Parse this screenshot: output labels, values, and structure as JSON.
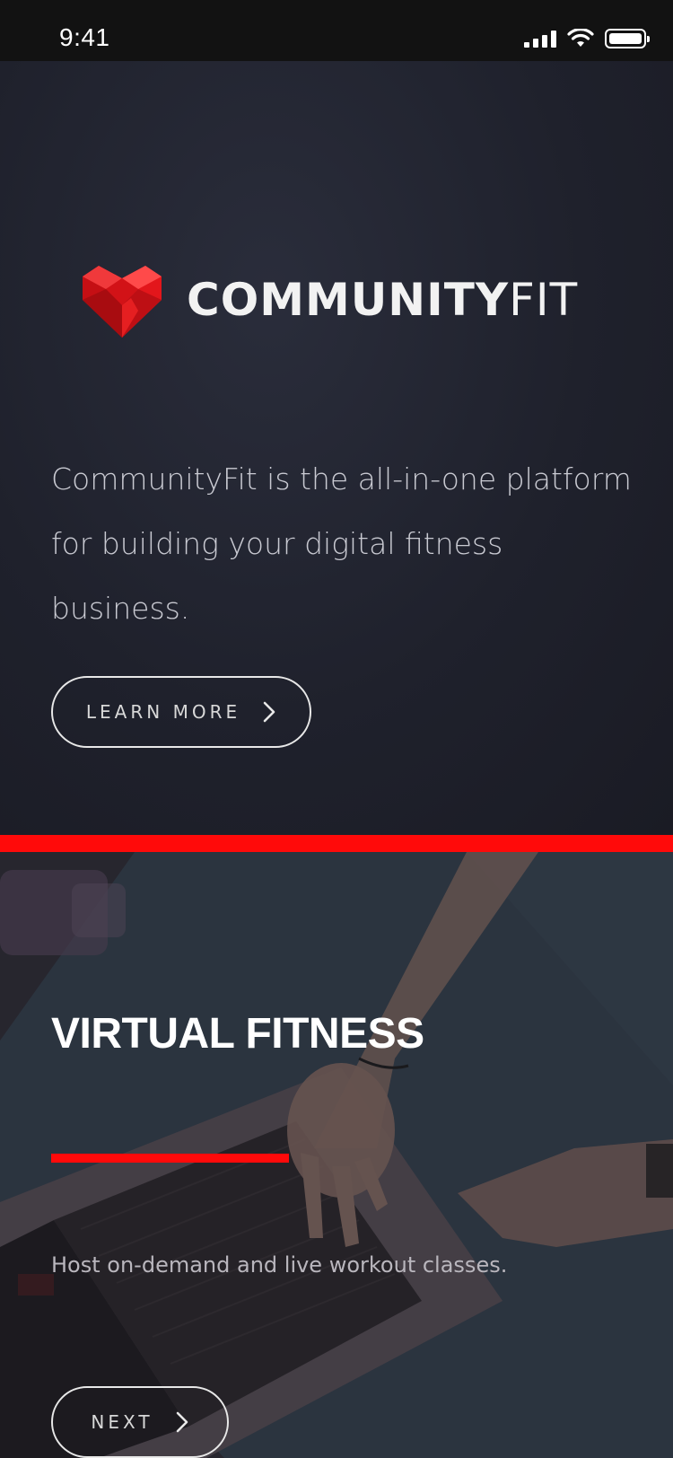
{
  "status_bar": {
    "time": "9:41"
  },
  "hero": {
    "logo": {
      "brand_strong": "COMMUNITY",
      "brand_light": "FIT",
      "accent_color": "#e3161b"
    },
    "description": "CommunityFit is the all-in-one platform for building your digital fitness business.",
    "learn_more_label": "LEARN MORE"
  },
  "feature": {
    "title": "VIRTUAL FITNESS",
    "description": "Host on-demand and live workout classes.",
    "next_label": "NEXT"
  },
  "colors": {
    "accent_red": "#ff0a0a",
    "hero_bg": "#1f212c"
  },
  "icons": {
    "learn_more_chevron": "chevron-right-icon",
    "next_chevron": "chevron-right-icon",
    "logo_mark": "heart-icon"
  }
}
